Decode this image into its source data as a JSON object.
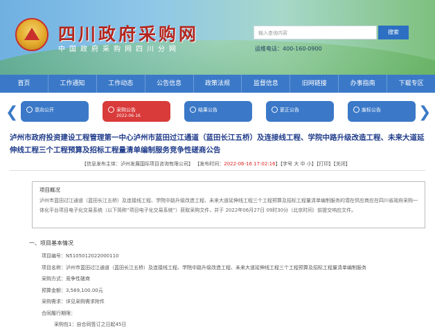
{
  "header": {
    "title": "四川政府采购网",
    "subtitle": "中国政府采购网四川分网",
    "search_placeholder": "输入查询内容",
    "search_label": "搜索",
    "hotline": "运维电话：400-160-0900"
  },
  "nav": [
    "首页",
    "工作通知",
    "工作动态",
    "公告信息",
    "政策法规",
    "监督信息",
    "旧网链接",
    "办事指南",
    "下载专区"
  ],
  "tabs": [
    {
      "label": "意向公开"
    },
    {
      "label": "采购公告",
      "date": "2022-06-16"
    },
    {
      "label": "结果公告"
    },
    {
      "label": "更正公告"
    },
    {
      "label": "废标公告"
    }
  ],
  "article": {
    "title": "泸州市政府投资建设工程管理第一中心泸州市蓝田过江通道（蓝田长江五桥）及连接线工程、学院中路升级改造工程、未来大道延伸线工程三个工程预算及招标工程量清单编制服务竞争性磋商公告",
    "meta_source": "【信息发布主体：泸州发展国际项目咨询有限公司】",
    "meta_time_label": "【发布时间：",
    "meta_time": "2022-06-16 17:02:16",
    "meta_font": "】【字号 大 中 小】【打印】【关闭】",
    "overview_head": "项目概况",
    "overview_body": "泸州市蓝田过江通道（蓝田长江五桥）及连接线工程、学院中路升级改造工程、未来大道延伸线工程三个工程预算及招标工程量清单编制服务的潜在供应商应在四川省政府采购一体化平台项目电子化交易系统（以下简称“项目电子化交易系统”）获取采购文件，并于 2022年06月27日 09时30分（北京时间）前提交响应文件。",
    "section_head": "一、项目基本情况",
    "info": [
      "项目编号：N5105012022000110",
      "项目名称：泸州市蓝田过江通道（蓝田长江五桥）及连接线工程、学院中路升级改造工程、未来大道延伸线工程三个工程预算及招标工程量清单编制服务",
      "采购方式：竞争性磋商",
      "预算金额：3,569,100.00元",
      "采购需求：详见采购需求附件",
      "合同履行期限：",
      "采购包1：自合同签订之日起45日"
    ]
  }
}
